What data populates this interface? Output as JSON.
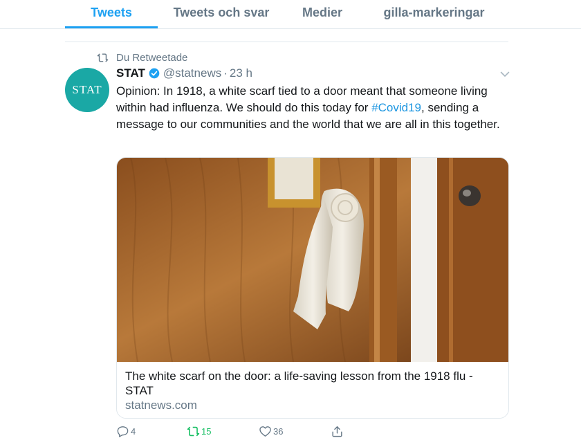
{
  "tabs": [
    {
      "label": "Tweets",
      "active": true
    },
    {
      "label": "Tweets och svar",
      "active": false
    },
    {
      "label": "Medier",
      "active": false
    },
    {
      "label": "gilla-markeringar",
      "active": false
    }
  ],
  "tweet": {
    "retweet_context": "Du Retweetade",
    "author": {
      "avatar_text": "STAT",
      "name": "STAT",
      "handle": "@statnews",
      "time": "23 h"
    },
    "text_before": "Opinion: In 1918, a white scarf tied to a door meant that someone living within had influenza. We should do this today for ",
    "hashtag": "#Covid19",
    "text_after": ", sending a message to our communities and the world that we are all in this together.",
    "card": {
      "title": "The white scarf on the door: a life-saving lesson from the 1918 flu - STAT",
      "domain": "statnews.com"
    },
    "actions": {
      "replies": "4",
      "retweets": "15",
      "likes": "36"
    }
  },
  "colors": {
    "accent": "#1da1f2",
    "avatar_bg": "#1aa8a5",
    "retweet_active": "#17bf63",
    "muted": "#657786"
  }
}
